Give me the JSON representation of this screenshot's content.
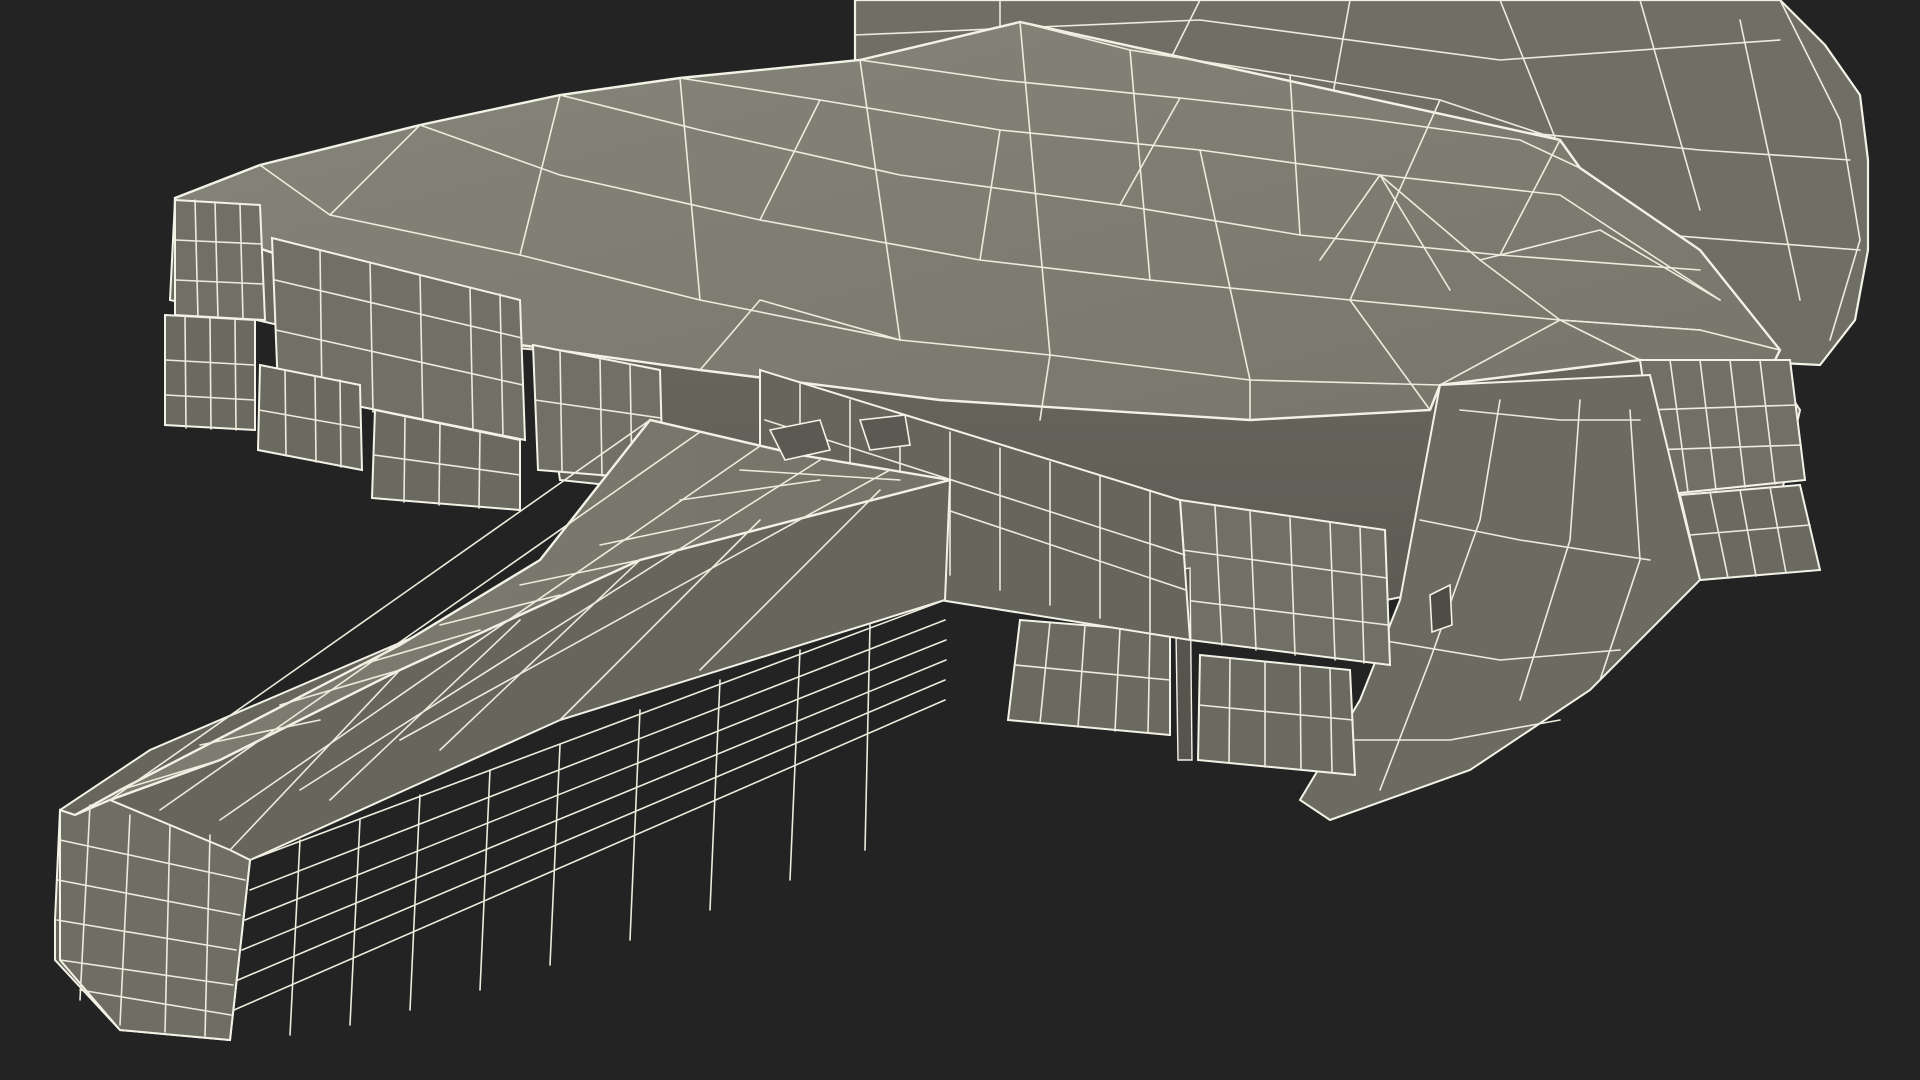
{
  "scene": {
    "subject": "wireframe-3d-model",
    "background_color": "#232323",
    "surface_color": "#7b7b70",
    "surface_shadow_color": "#626259",
    "surface_light_color": "#85857a",
    "wire_color": "#ecebdc"
  }
}
